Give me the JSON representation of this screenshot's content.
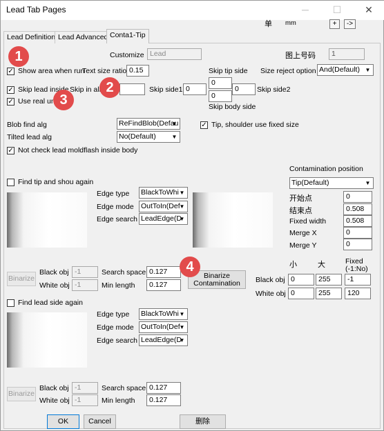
{
  "window": {
    "title": "Lead Tab Pages",
    "minimize": "─",
    "maximize": "☐",
    "close": "✕"
  },
  "toolbar": {
    "unit_char": "单",
    "unit": "mm",
    "plus": "+",
    "arrow": "->"
  },
  "tabs": [
    "Lead Definition",
    "Lead Advanced",
    "Conta1-Tip"
  ],
  "top": {
    "customize_label": "Customize",
    "customize_value": "Lead",
    "figure_label": "图上号码",
    "figure_value": "1",
    "show_area": "Show area when run",
    "text_size_ratio_label": "Text size ratio",
    "text_size_ratio_value": "0.15",
    "skip_tip_side": "Skip tip side",
    "size_reject_label": "Size reject option",
    "size_reject_value": "And(Default)",
    "skip_lead_inside": "Skip lead inside",
    "skip_in_all": "Skip in all",
    "skip_side1": "Skip side1",
    "skip_side1_value": "0",
    "skip_tip_top": "0",
    "skip_tip_bottom": "0",
    "skip_side2_value": "0",
    "skip_side2": "Skip side2",
    "use_real_unit": "Use real unit",
    "skip_body_side": "Skip body side",
    "blob_find_label": "Blob find alg",
    "blob_find_value": "ReFindBlob(Defau",
    "tip_shoulder": "Tip, shoulder use fixed size",
    "tilted_lead_label": "Tilted lead alg",
    "tilted_lead_value": "No(Default)",
    "not_check": "Not check  lead moldflash inside body"
  },
  "tip_section": {
    "find_tip": "Find tip and shou again",
    "edge_type_label": "Edge type",
    "edge_type_value": "BlackToWhi",
    "edge_mode_label": "Edge mode",
    "edge_mode_value": "OutToIn(Def",
    "edge_search_label": "Edge search",
    "edge_search_value": "LeadEdge(D",
    "binarize": "Binarize",
    "black_obj": "Black obj",
    "black_obj_value": "-1",
    "white_obj": "White obj",
    "white_obj_value": "-1",
    "search_space_label": "Search space",
    "search_space_value": "0.127",
    "min_length_label": "Min length",
    "min_length_value": "0.127",
    "binarize_contamination": "Binarize\nContamination"
  },
  "contamination": {
    "position_label": "Contamination position",
    "position_value": "Tip(Default)",
    "start_label": "开始点",
    "start_value": "0",
    "end_label": "结束点",
    "end_value": "0.508",
    "fixed_width_label": "Fixed width",
    "fixed_width_value": "0.508",
    "merge_x_label": "Merge X",
    "merge_x_value": "0",
    "merge_y_label": "Merge Y",
    "merge_y_value": "0",
    "small": "小",
    "large": "大",
    "fixed": "Fixed\n(-1:No)",
    "black_obj": "Black obj",
    "black_small": "0",
    "black_large": "255",
    "black_fixed": "-1",
    "white_obj": "White obj",
    "white_small": "0",
    "white_large": "255",
    "white_fixed": "120"
  },
  "lead_section": {
    "find_lead": "Find lead side again",
    "edge_type_label": "Edge type",
    "edge_type_value": "BlackToWhi",
    "edge_mode_label": "Edge mode",
    "edge_mode_value": "OutToIn(Def",
    "edge_search_label": "Edge search",
    "edge_search_value": "LeadEdge(D",
    "binarize": "Binarize",
    "black_obj": "Black obj",
    "black_obj_value": "-1",
    "white_obj": "White obj",
    "white_obj_value": "-1",
    "search_space_label": "Search space",
    "search_space_value": "0.127",
    "min_length_label": "Min length",
    "min_length_value": "0.127"
  },
  "footer": {
    "ok": "OK",
    "cancel": "Cancel",
    "delete": "删除"
  },
  "markers": [
    "1",
    "2",
    "3",
    "4"
  ],
  "colors": {
    "marker": "#e24b4b"
  }
}
